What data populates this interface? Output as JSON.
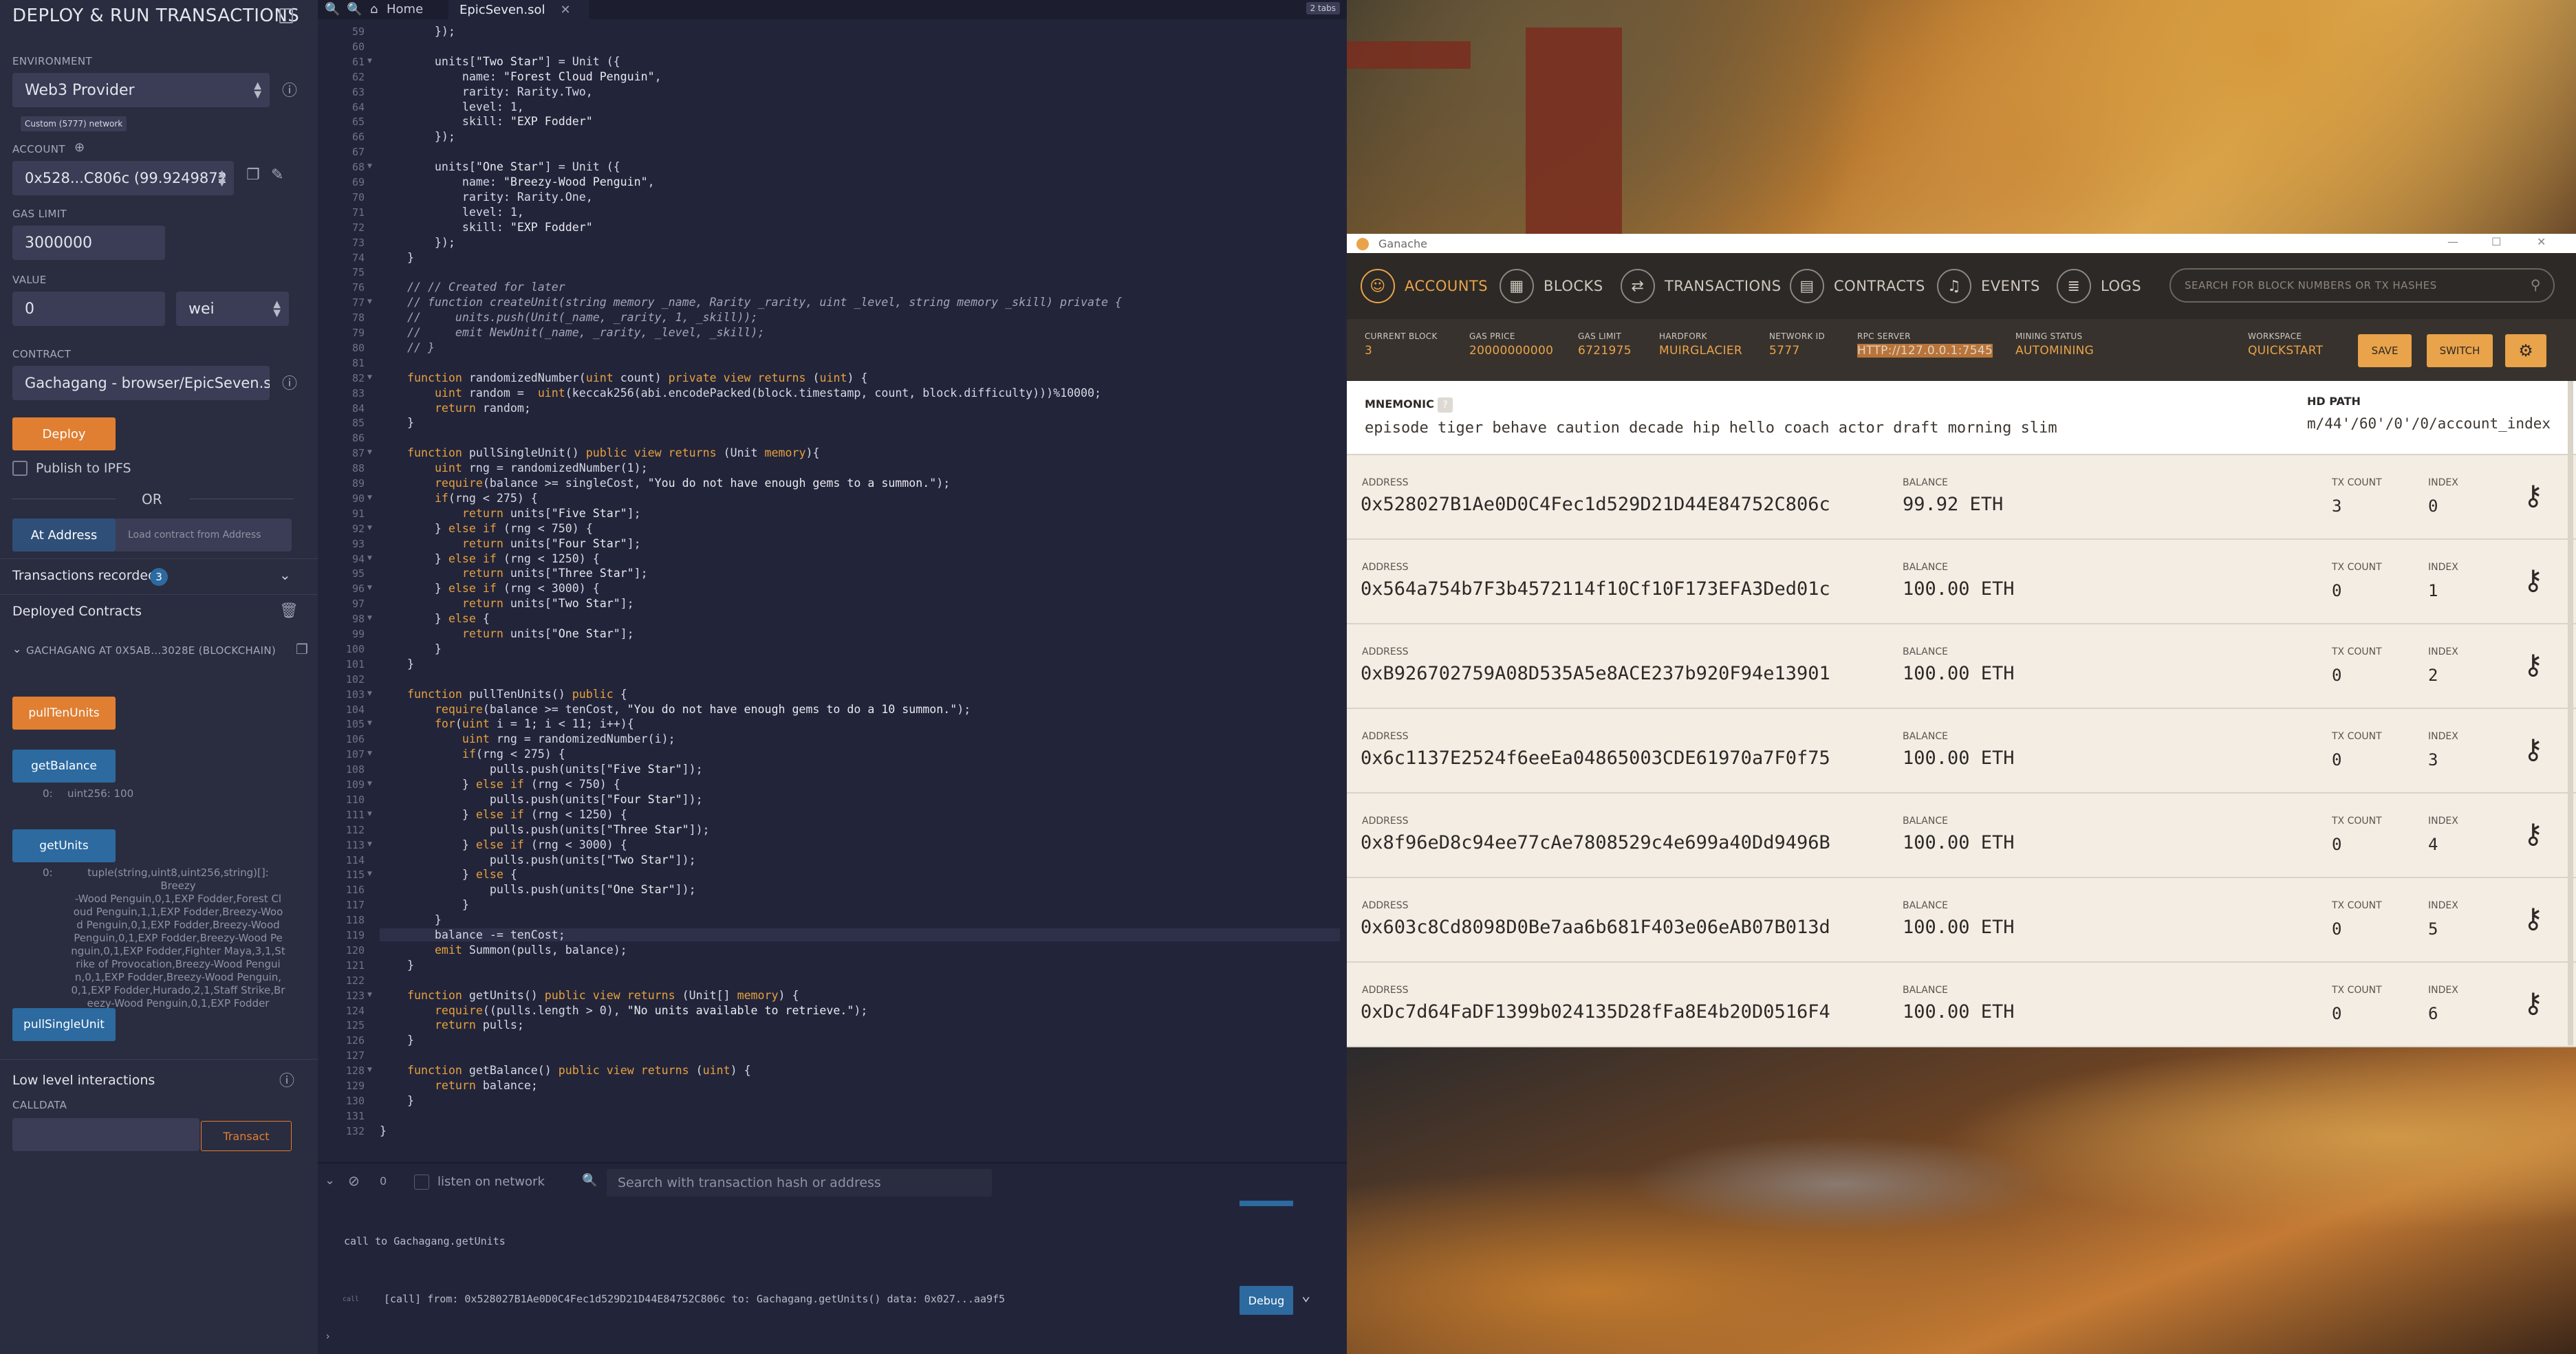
{
  "left": {
    "title": "DEPLOY & RUN TRANSACTIONS",
    "env_label": "ENVIRONMENT",
    "env_value": "Web3 Provider",
    "env_badge": "Custom (5777) network",
    "account_label": "ACCOUNT",
    "account_value": "0x528...C806c (99.9249872",
    "gas_label": "GAS LIMIT",
    "gas_value": "3000000",
    "value_label": "VALUE",
    "value_value": "0",
    "value_unit": "wei",
    "contract_label": "CONTRACT",
    "contract_value": "Gachagang - browser/EpicSeven.sol",
    "deploy": "Deploy",
    "publish": "Publish to IPFS",
    "or": "OR",
    "at_address": "At Address",
    "load_placeholder": "Load contract from Address",
    "tx_recorded": "Transactions recorded",
    "tx_count": "3",
    "deployed": "Deployed Contracts",
    "instance": "GACHAGANG AT 0X5AB...3028E (BLOCKCHAIN)",
    "fn_pullTen": "pullTenUnits",
    "fn_getBalance": "getBalance",
    "bal_idx": "0:",
    "bal_out": "uint256: 100",
    "fn_getUnits": "getUnits",
    "units_idx": "0:",
    "units_out": [
      "tuple(string,uint8,uint256,string)[]: Breezy",
      "-Wood Penguin,0,1,EXP Fodder,Forest Cl",
      "oud Penguin,1,1,EXP Fodder,Breezy-Woo",
      "d Penguin,0,1,EXP Fodder,Breezy-Wood",
      "Penguin,0,1,EXP Fodder,Breezy-Wood Pe",
      "nguin,0,1,EXP Fodder,Fighter Maya,3,1,St",
      "rike of Provocation,Breezy-Wood Pengui",
      "n,0,1,EXP Fodder,Breezy-Wood Penguin,",
      "0,1,EXP Fodder,Hurado,2,1,Staff Strike,Br",
      "eezy-Wood Penguin,0,1,EXP Fodder"
    ],
    "fn_pullSingle": "pullSingleUnit",
    "low_level": "Low level interactions",
    "calldata": "CALLDATA",
    "transact": "Transact"
  },
  "editor": {
    "tab_home": "Home",
    "tab_file": "EpicSeven.sol",
    "tab_count": "2 tabs",
    "lines": [
      {
        "n": "59",
        "t": "        });"
      },
      {
        "n": "60",
        "t": ""
      },
      {
        "n": "61",
        "t": "        units[\"Two Star\"] = Unit ({"
      },
      {
        "n": "62",
        "t": "            name: \"Forest Cloud Penguin\","
      },
      {
        "n": "63",
        "t": "            rarity: Rarity.Two,"
      },
      {
        "n": "64",
        "t": "            level: 1,"
      },
      {
        "n": "65",
        "t": "            skill: \"EXP Fodder\""
      },
      {
        "n": "66",
        "t": "        });"
      },
      {
        "n": "67",
        "t": ""
      },
      {
        "n": "68",
        "t": "        units[\"One Star\"] = Unit ({"
      },
      {
        "n": "69",
        "t": "            name: \"Breezy-Wood Penguin\","
      },
      {
        "n": "70",
        "t": "            rarity: Rarity.One,"
      },
      {
        "n": "71",
        "t": "            level: 1,"
      },
      {
        "n": "72",
        "t": "            skill: \"EXP Fodder\""
      },
      {
        "n": "73",
        "t": "        });"
      },
      {
        "n": "74",
        "t": "    }"
      },
      {
        "n": "75",
        "t": ""
      },
      {
        "n": "76",
        "t": "    // // Created for later"
      },
      {
        "n": "77",
        "t": "    // function createUnit(string memory _name, Rarity _rarity, uint _level, string memory _skill) private {"
      },
      {
        "n": "78",
        "t": "    //     units.push(Unit(_name, _rarity, 1, _skill));"
      },
      {
        "n": "79",
        "t": "    //     emit NewUnit(_name, _rarity, _level, _skill);"
      },
      {
        "n": "80",
        "t": "    // }"
      },
      {
        "n": "81",
        "t": ""
      },
      {
        "n": "82",
        "t": "    function randomizedNumber(uint count) private view returns (uint) {"
      },
      {
        "n": "83",
        "t": "        uint random =  uint(keccak256(abi.encodePacked(block.timestamp, count, block.difficulty)))%10000;"
      },
      {
        "n": "84",
        "t": "        return random;"
      },
      {
        "n": "85",
        "t": "    }"
      },
      {
        "n": "86",
        "t": ""
      },
      {
        "n": "87",
        "t": "    function pullSingleUnit() public view returns (Unit memory){"
      },
      {
        "n": "88",
        "t": "        uint rng = randomizedNumber(1);"
      },
      {
        "n": "89",
        "t": "        require(balance >= singleCost, \"You do not have enough gems to a summon.\");"
      },
      {
        "n": "90",
        "t": "        if(rng < 275) {"
      },
      {
        "n": "91",
        "t": "            return units[\"Five Star\"];"
      },
      {
        "n": "92",
        "t": "        } else if (rng < 750) {"
      },
      {
        "n": "93",
        "t": "            return units[\"Four Star\"];"
      },
      {
        "n": "94",
        "t": "        } else if (rng < 1250) {"
      },
      {
        "n": "95",
        "t": "            return units[\"Three Star\"];"
      },
      {
        "n": "96",
        "t": "        } else if (rng < 3000) {"
      },
      {
        "n": "97",
        "t": "            return units[\"Two Star\"];"
      },
      {
        "n": "98",
        "t": "        } else {"
      },
      {
        "n": "99",
        "t": "            return units[\"One Star\"];"
      },
      {
        "n": "100",
        "t": "        }"
      },
      {
        "n": "101",
        "t": "    }"
      },
      {
        "n": "102",
        "t": ""
      },
      {
        "n": "103",
        "t": "    function pullTenUnits() public {"
      },
      {
        "n": "104",
        "t": "        require(balance >= tenCost, \"You do not have enough gems to do a 10 summon.\");"
      },
      {
        "n": "105",
        "t": "        for(uint i = 1; i < 11; i++){"
      },
      {
        "n": "106",
        "t": "            uint rng = randomizedNumber(i);"
      },
      {
        "n": "107",
        "t": "            if(rng < 275) {"
      },
      {
        "n": "108",
        "t": "                pulls.push(units[\"Five Star\"]);"
      },
      {
        "n": "109",
        "t": "            } else if (rng < 750) {"
      },
      {
        "n": "110",
        "t": "                pulls.push(units[\"Four Star\"]);"
      },
      {
        "n": "111",
        "t": "            } else if (rng < 1250) {"
      },
      {
        "n": "112",
        "t": "                pulls.push(units[\"Three Star\"]);"
      },
      {
        "n": "113",
        "t": "            } else if (rng < 3000) {"
      },
      {
        "n": "114",
        "t": "                pulls.push(units[\"Two Star\"]);"
      },
      {
        "n": "115",
        "t": "            } else {"
      },
      {
        "n": "116",
        "t": "                pulls.push(units[\"One Star\"]);"
      },
      {
        "n": "117",
        "t": "            }"
      },
      {
        "n": "118",
        "t": "        }"
      },
      {
        "n": "119",
        "t": "        balance -= tenCost;"
      },
      {
        "n": "120",
        "t": "        emit Summon(pulls, balance);"
      },
      {
        "n": "121",
        "t": "    }"
      },
      {
        "n": "122",
        "t": ""
      },
      {
        "n": "123",
        "t": "    function getUnits() public view returns (Unit[] memory) {"
      },
      {
        "n": "124",
        "t": "        require((pulls.length > 0), \"No units available to retrieve.\");"
      },
      {
        "n": "125",
        "t": "        return pulls;"
      },
      {
        "n": "126",
        "t": "    }"
      },
      {
        "n": "127",
        "t": ""
      },
      {
        "n": "128",
        "t": "    function getBalance() public view returns (uint) {"
      },
      {
        "n": "129",
        "t": "        return balance;"
      },
      {
        "n": "130",
        "t": "    }"
      },
      {
        "n": "131",
        "t": ""
      },
      {
        "n": "132",
        "t": "}"
      }
    ],
    "terminal_count": "0",
    "listen": "listen on network",
    "search_ph": "Search with transaction hash or address",
    "log_call": "call to Gachagang.getUnits",
    "log_tag": "call",
    "log_detail": "[call]  from: 0x528027B1Ae0D0C4Fec1d529D21D44E84752C806c to: Gachagang.getUnits() data: 0x027...aa9f5",
    "debug": "Debug"
  },
  "ganache": {
    "window_title": "Ganache",
    "nav": [
      "ACCOUNTS",
      "BLOCKS",
      "TRANSACTIONS",
      "CONTRACTS",
      "EVENTS",
      "LOGS"
    ],
    "search_ph": "SEARCH FOR BLOCK NUMBERS OR TX HASHES",
    "stats": [
      {
        "k": "CURRENT BLOCK",
        "v": "3"
      },
      {
        "k": "GAS PRICE",
        "v": "20000000000"
      },
      {
        "k": "GAS LIMIT",
        "v": "6721975"
      },
      {
        "k": "HARDFORK",
        "v": "MUIRGLACIER"
      },
      {
        "k": "NETWORK ID",
        "v": "5777"
      },
      {
        "k": "RPC SERVER",
        "v": "HTTP://127.0.0.1:7545"
      },
      {
        "k": "MINING STATUS",
        "v": "AUTOMINING"
      },
      {
        "k": "WORKSPACE",
        "v": "QUICKSTART"
      }
    ],
    "save": "SAVE",
    "switch": "SWITCH",
    "mnemonic_label": "MNEMONIC",
    "mnemonic": "episode tiger behave caution decade hip hello coach actor draft morning slim",
    "hd_label": "HD PATH",
    "hd": "m/44'/60'/0'/0/account_index",
    "h_address": "ADDRESS",
    "h_balance": "BALANCE",
    "h_tx": "TX COUNT",
    "h_index": "INDEX",
    "accounts": [
      {
        "addr": "0x528027B1Ae0D0C4Fec1d529D21D44E84752C806c",
        "bal": "99.92 ETH",
        "tx": "3",
        "idx": "0"
      },
      {
        "addr": "0x564a754b7F3b4572114f10Cf10F173EFA3Ded01c",
        "bal": "100.00 ETH",
        "tx": "0",
        "idx": "1"
      },
      {
        "addr": "0xB926702759A08D535A5e8ACE237b920F94e13901",
        "bal": "100.00 ETH",
        "tx": "0",
        "idx": "2"
      },
      {
        "addr": "0x6c1137E2524f6eeEa04865003CDE61970a7F0f75",
        "bal": "100.00 ETH",
        "tx": "0",
        "idx": "3"
      },
      {
        "addr": "0x8f96eD8c94ee77cAe7808529c4e699a40Dd9496B",
        "bal": "100.00 ETH",
        "tx": "0",
        "idx": "4"
      },
      {
        "addr": "0x603c8Cd8098D0Be7aa6b681F403e06eAB07B013d",
        "bal": "100.00 ETH",
        "tx": "0",
        "idx": "5"
      },
      {
        "addr": "0xDc7d64FaDF1399b024135D28fFa8E4b20D0516F4",
        "bal": "100.00 ETH",
        "tx": "0",
        "idx": "6"
      }
    ]
  }
}
